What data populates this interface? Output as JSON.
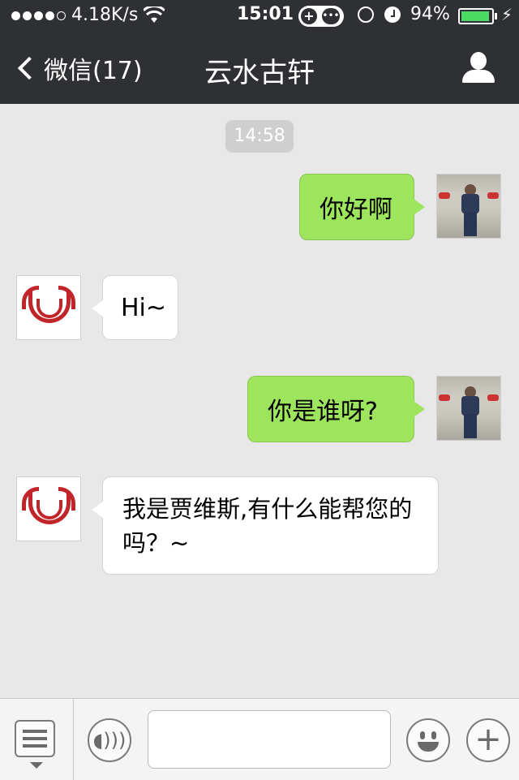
{
  "status_bar": {
    "signal_dots": 5,
    "signal_filled": 4,
    "net_speed": "4.18K/s",
    "time": "15:01",
    "battery_percent": "94%",
    "battery_level": 0.94
  },
  "nav": {
    "back_label": "微信(17)",
    "title": "云水古轩"
  },
  "chat": {
    "timestamp": "14:58",
    "messages": [
      {
        "direction": "outgoing",
        "text": "你好啊",
        "avatar": "user-photo"
      },
      {
        "direction": "incoming",
        "text": "Hi~",
        "avatar": "brand-logo"
      },
      {
        "direction": "outgoing",
        "text": "你是谁呀?",
        "avatar": "user-photo"
      },
      {
        "direction": "incoming",
        "text": "我是贾维斯,有什么能帮您的吗？~",
        "avatar": "brand-logo"
      }
    ]
  },
  "colors": {
    "nav_bg": "#2e3033",
    "outgoing_bubble": "#9ee55e",
    "incoming_bubble": "#ffffff",
    "chat_bg": "#e8e8e8"
  },
  "toolbar": {
    "input_value": "",
    "icons": [
      "menu-icon",
      "voice-icon",
      "emoji-icon",
      "plus-icon"
    ]
  }
}
